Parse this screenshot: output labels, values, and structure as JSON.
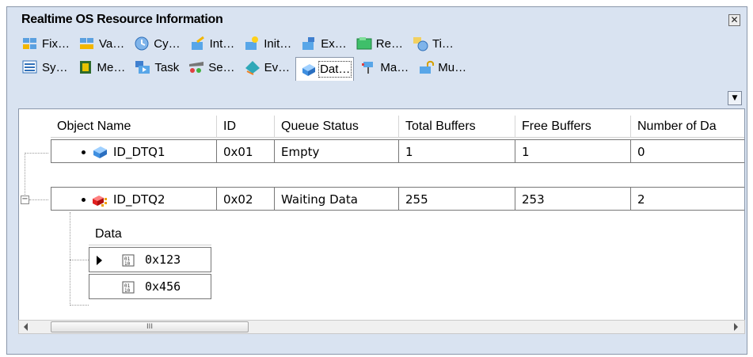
{
  "window": {
    "title": "Realtime OS Resource Information",
    "close_glyph": "✕"
  },
  "tabs_row1": [
    {
      "label": "Fix…",
      "icon": "fixed-memory-icon"
    },
    {
      "label": "Va…",
      "icon": "variable-memory-icon"
    },
    {
      "label": "Cy…",
      "icon": "cyclic-handler-icon"
    },
    {
      "label": "Int…",
      "icon": "interrupt-handler-icon"
    },
    {
      "label": "Init…",
      "icon": "init-routine-icon"
    },
    {
      "label": "Ex…",
      "icon": "exception-icon"
    },
    {
      "label": "Re…",
      "icon": "ready-queue-icon"
    },
    {
      "label": "Ti…",
      "icon": "timer-icon"
    }
  ],
  "tabs_row2": [
    {
      "label": "Sy…",
      "icon": "system-icon"
    },
    {
      "label": "Me…",
      "icon": "memory-icon"
    },
    {
      "label": "Task",
      "icon": "task-icon"
    },
    {
      "label": "Se…",
      "icon": "semaphore-icon"
    },
    {
      "label": "Ev…",
      "icon": "eventflag-icon"
    },
    {
      "label": "Dat…",
      "icon": "data-queue-icon",
      "active": true
    },
    {
      "label": "Ma…",
      "icon": "mailbox-icon"
    },
    {
      "label": "Mu…",
      "icon": "mutex-icon"
    }
  ],
  "table": {
    "headers": [
      "Object Name",
      "ID",
      "Queue Status",
      "Total Buffers",
      "Free Buffers",
      "Number of Da"
    ],
    "rows": [
      {
        "name": "ID_DTQ1",
        "id": "0x01",
        "status": "Empty",
        "total": "1",
        "free": "1",
        "count": "0"
      },
      {
        "name": "ID_DTQ2",
        "id": "0x02",
        "status": "Waiting Data",
        "total": "255",
        "free": "253",
        "count": "2"
      }
    ]
  },
  "subtable": {
    "header": "Data",
    "rows": [
      {
        "value": "0x123",
        "selected": true
      },
      {
        "value": "0x456",
        "selected": false
      }
    ]
  },
  "scrollbar": {
    "thumb_grip": "III"
  },
  "colors": {
    "window_bg": "#d9e3f1",
    "border": "#8a97ab"
  }
}
